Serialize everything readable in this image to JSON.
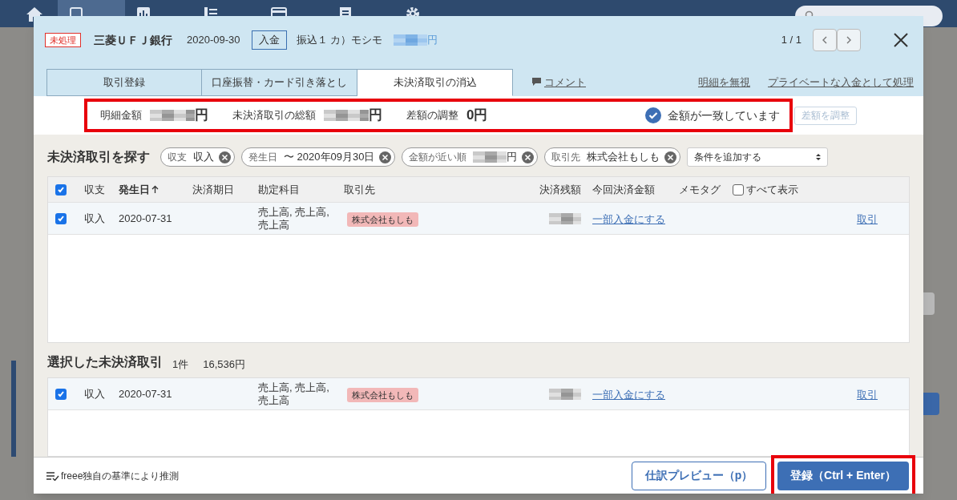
{
  "dialog": {
    "status": "未処理",
    "bank": "三菱ＵＦＪ銀行",
    "date": "2020-09-30",
    "direction": "入金",
    "description": "振込１ カ）モシモ",
    "amount_unit": "円",
    "pager": "1 / 1",
    "tabs": [
      {
        "label": "取引登録",
        "selected": false
      },
      {
        "label": "口座振替・カード引き落とし",
        "selected": false
      },
      {
        "label": "未決済取引の消込",
        "selected": true
      }
    ],
    "comment_link": "コメント",
    "links": [
      "明細を無視",
      "プライベートな入金として処理"
    ]
  },
  "summary": {
    "highlighted": true,
    "items": [
      {
        "label": "明細金額",
        "kind": "masked",
        "value": "円"
      },
      {
        "label": "未決済取引の総額",
        "kind": "masked",
        "value": "円"
      },
      {
        "label": "差額の調整",
        "kind": "plain",
        "value": "0円"
      }
    ],
    "matched": true,
    "match_message": "金額が一致しています",
    "adjust_button": {
      "label": "差額を調整",
      "disabled": true
    }
  },
  "search": {
    "title": "未決済取引を探す",
    "filters": [
      {
        "label": "収支",
        "value": "収入",
        "kind": "plain"
      },
      {
        "label": "発生日",
        "value": "〜 2020年09月30日",
        "kind": "plain"
      },
      {
        "label": "金額が近い順",
        "value": "円",
        "kind": "masked"
      },
      {
        "label": "取引先",
        "value": "株式会社もしも",
        "kind": "plain"
      }
    ],
    "add_condition": "条件を追加する",
    "table": {
      "all_checked": true,
      "columns": [
        {
          "label": "収支",
          "sorted": false
        },
        {
          "label": "発生日",
          "sorted": true
        },
        {
          "label": "決済期日",
          "sorted": false
        },
        {
          "label": "勘定科目",
          "sorted": false
        },
        {
          "label": "取引先",
          "sorted": false
        },
        {
          "label": "決済残額",
          "sorted": false
        },
        {
          "label": "今回決済金額",
          "sorted": false
        },
        {
          "label": "メモタグ",
          "sorted": false
        }
      ],
      "show_all": {
        "label": "すべて表示",
        "checked": false
      },
      "rows": [
        {
          "checked": true,
          "type": "収入",
          "date": "2020-07-31",
          "accounts": "売上高, 売上高, 売上高",
          "partner": "株式会社もしも",
          "partial_link": "一部入金にする",
          "link": "取引"
        }
      ]
    }
  },
  "selected": {
    "title": "選択した未決済取引",
    "count": "1件",
    "total": "16,536円",
    "rows": [
      {
        "checked": true,
        "type": "収入",
        "date": "2020-07-31",
        "accounts": "売上高, 売上高, 売上高",
        "partner": "株式会社もしも",
        "partial_link": "一部入金にする",
        "link": "取引"
      }
    ]
  },
  "footer": {
    "note": "freee独自の基準により推測",
    "preview_button": "仕訳プレビュー（p）",
    "submit_button": "登録（Ctrl + Enter）",
    "highlighted": true
  }
}
